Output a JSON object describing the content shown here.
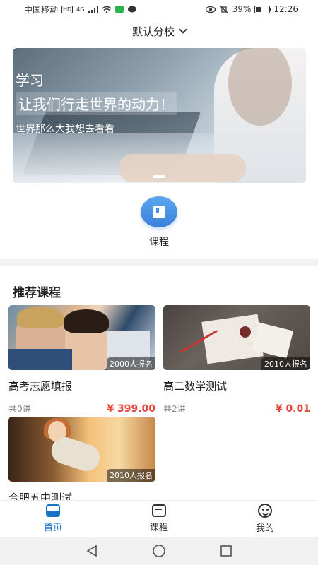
{
  "status_bar": {
    "carrier": "中国移动",
    "hd": "HD",
    "network": "4G",
    "battery": "39%",
    "battery_level": 0.39,
    "time": "12:26"
  },
  "campus": {
    "label": "默认分校"
  },
  "banner": {
    "title1": "学习",
    "title2": "让我们行走世界的动力！",
    "subtitle": "世界那么大我想去看看"
  },
  "entry": {
    "label": "课程"
  },
  "recommended": {
    "title": "推荐课程",
    "courses": [
      {
        "name": "高考志愿填报",
        "enrolled": "2000人报名",
        "lectures": "共0讲",
        "price": "¥ 399.00"
      },
      {
        "name": "高二数学测试",
        "enrolled": "2010人报名",
        "lectures": "共2讲",
        "price": "¥ 0.01"
      },
      {
        "name": "合肥五中测试",
        "enrolled": "2010人报名"
      }
    ]
  },
  "tabbar": {
    "home": "首页",
    "courses": "课程",
    "mine": "我的"
  },
  "colors": {
    "accent": "#1a73c4",
    "price": "#e8453c"
  }
}
